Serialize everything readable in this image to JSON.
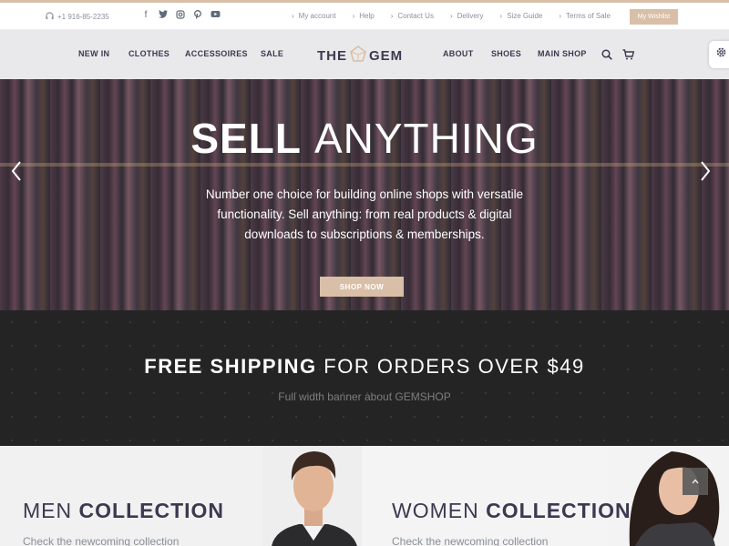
{
  "topbar": {
    "phone": "+1 916-85-2235",
    "social_icons": [
      "facebook-icon",
      "twitter-icon",
      "instagram-icon",
      "pinterest-icon",
      "youtube-icon"
    ],
    "links": [
      "My account",
      "Help",
      "Contact Us",
      "Delivery",
      "Size Guide",
      "Terms of Sale"
    ],
    "wishlist_label": "My Wishlist"
  },
  "nav": {
    "left": [
      "NEW IN",
      "CLOTHES",
      "ACCESSOIRES",
      "SALE"
    ],
    "logo_left": "THE",
    "logo_right": "GEM",
    "right": [
      "ABOUT",
      "SHOES",
      "MAIN SHOP"
    ]
  },
  "hero": {
    "title_bold": "SELL",
    "title_light": "ANYTHING",
    "subtitle": "Number one choice for building online shops with versatile functionality. Sell anything: from real products & digital downloads to subscriptions & memberships.",
    "button_label": "SHOP NOW"
  },
  "shipping": {
    "title_bold": "FREE SHIPPING",
    "title_light": "FOR ORDERS OVER $49",
    "subtitle": "Full width banner about GEMSHOP"
  },
  "collections": {
    "men": {
      "light": "MEN",
      "bold": "COLLECTION",
      "sub": "Check the newcoming collection"
    },
    "women": {
      "light": "WOMEN",
      "bold": "COLLECTION",
      "sub": "Check the newcoming collection"
    }
  },
  "colors": {
    "accent": "#d9bfa7",
    "dark": "#242424",
    "text": "#3c3950"
  }
}
